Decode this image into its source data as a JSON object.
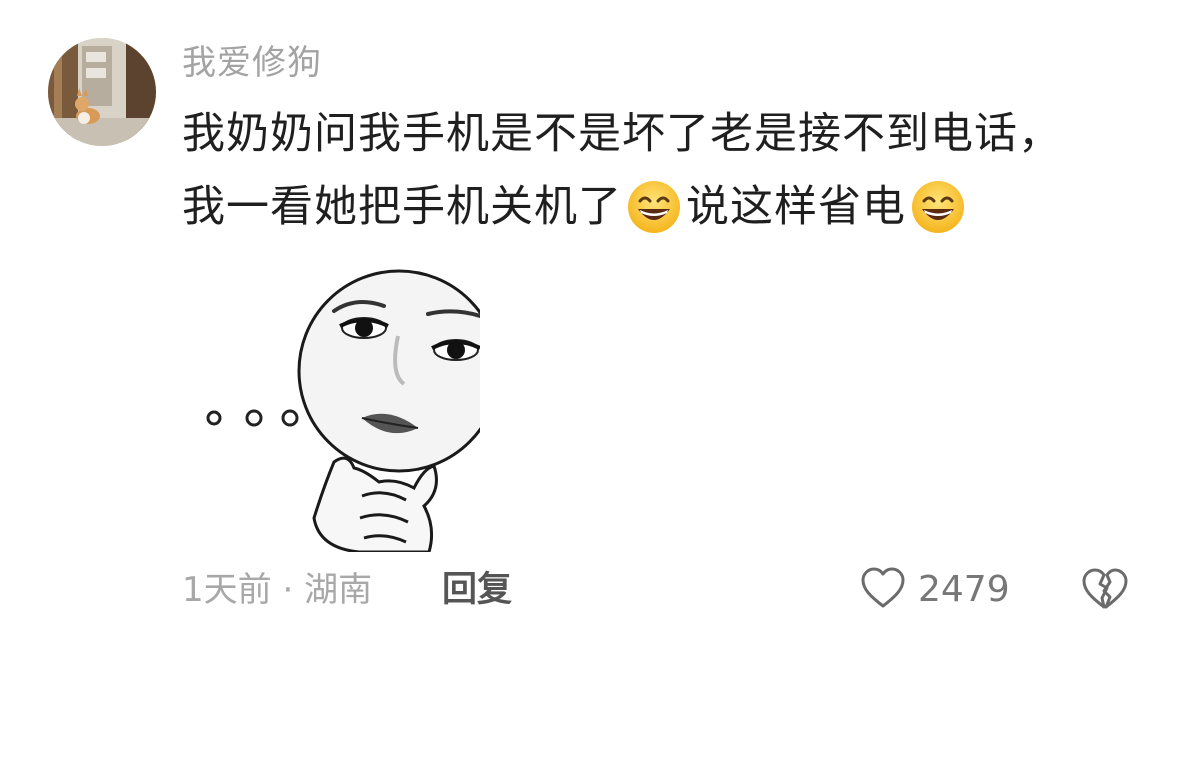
{
  "comment": {
    "username": "我爱修狗",
    "avatar_icon": "corgi-photo-avatar",
    "text_line1": "我奶奶问我手机是不是坏了老是接不到电话，",
    "text_line2_part1": "我一看她把手机关机了",
    "text_line2_part2": "说这样省电",
    "emoji_icon": "grinning-face-emoji",
    "sticker_icon": "thinking-face-sticker",
    "time": "1天前",
    "separator": "·",
    "location": "湖南",
    "reply_label": "回复",
    "like_icon": "heart-icon",
    "like_count": "2479",
    "dislike_icon": "broken-heart-icon"
  }
}
